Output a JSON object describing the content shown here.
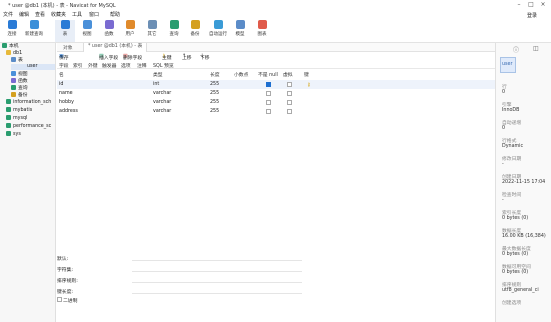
{
  "window": {
    "title": "* user @db1 (本机) - 表 - Navicat for MySQL",
    "login": "登录"
  },
  "menu": [
    "文件",
    "编辑",
    "查看",
    "收藏夹",
    "工具",
    "窗口",
    "帮助"
  ],
  "toolbar": [
    {
      "label": "连接",
      "color": "#2a7bd6"
    },
    {
      "label": "新建查询",
      "color": "#3b8fd9"
    },
    {
      "label": "表",
      "color": "#2a7bd6"
    },
    {
      "label": "视图",
      "color": "#4a90d9"
    },
    {
      "label": "函数",
      "color": "#7a6bd1"
    },
    {
      "label": "用户",
      "color": "#e08a2b"
    },
    {
      "label": "其它",
      "color": "#6c8fb5"
    },
    {
      "label": "查询",
      "color": "#2a9d6f"
    },
    {
      "label": "备份",
      "color": "#d4a020"
    },
    {
      "label": "自动运行",
      "color": "#3a9bd6"
    },
    {
      "label": "模型",
      "color": "#5b8cc8"
    },
    {
      "label": "图表",
      "color": "#e05a4a"
    }
  ],
  "sidebar": {
    "nodes": [
      {
        "label": "本机",
        "color": "#2a9d6f"
      },
      {
        "label": "db1",
        "color": "#e7b93a"
      },
      {
        "label": "表",
        "color": "#5b8cc8"
      },
      {
        "label": "user",
        "color": "#5b8cc8"
      },
      {
        "label": "视图",
        "color": "#4a90d9"
      },
      {
        "label": "函数",
        "color": "#7a6bd1"
      },
      {
        "label": "查询",
        "color": "#2a9d6f"
      },
      {
        "label": "备份",
        "color": "#d4a020"
      },
      {
        "label": "information_sch",
        "color": "#2a9d6f"
      },
      {
        "label": "mybatis",
        "color": "#2a9d6f"
      },
      {
        "label": "mysql",
        "color": "#2a9d6f"
      },
      {
        "label": "performance_sc",
        "color": "#2a9d6f"
      },
      {
        "label": "sys",
        "color": "#2a9d6f"
      }
    ]
  },
  "tabs": {
    "objects": "对象",
    "active": "* user @db1 (本机) - 表"
  },
  "designbar": {
    "save": "保存",
    "add_field": "插入字段",
    "delete_field": "删除字段",
    "primary_key": "主键",
    "up": "上移",
    "down": "下移"
  },
  "subtabs": [
    "字段",
    "索引",
    "外键",
    "触发器",
    "选项",
    "注释",
    "SQL 预览"
  ],
  "grid": {
    "headers": [
      "名",
      "类型",
      "长度",
      "小数点",
      "不是 null",
      "虚拟",
      "键"
    ],
    "rows": [
      {
        "name": "id",
        "type": "int",
        "length": "255",
        "notnull": true,
        "virtual": false,
        "key": true
      },
      {
        "name": "name",
        "type": "varchar",
        "length": "255",
        "notnull": false,
        "virtual": false,
        "key": false
      },
      {
        "name": "hobby",
        "type": "varchar",
        "length": "255",
        "notnull": false,
        "virtual": false,
        "key": false
      },
      {
        "name": "address",
        "type": "varchar",
        "length": "255",
        "notnull": false,
        "virtual": false,
        "key": false
      }
    ]
  },
  "props": {
    "default": "默认:",
    "charset": "字符集:",
    "collation": "排序规则:",
    "key_length": "键长度:",
    "binary": "二进制"
  },
  "right_panel": {
    "table_name": "user",
    "items": [
      {
        "k": "行",
        "v": "0"
      },
      {
        "k": "引擎",
        "v": "InnoDB"
      },
      {
        "k": "自动递增",
        "v": "0"
      },
      {
        "k": "行格式",
        "v": "Dynamic"
      },
      {
        "k": "修改日期",
        "v": "-"
      },
      {
        "k": "创建日期",
        "v": "2022-11-15 17:04"
      },
      {
        "k": "检查时间",
        "v": "-"
      },
      {
        "k": "索引长度",
        "v": "0 bytes (0)"
      },
      {
        "k": "数据长度",
        "v": "16.00 KB (16,384)"
      },
      {
        "k": "最大数据长度",
        "v": "0 bytes (0)"
      },
      {
        "k": "数据可用空间",
        "v": "0 bytes (0)"
      },
      {
        "k": "排序规则",
        "v": "utf8_general_ci"
      },
      {
        "k": "创建选项",
        "v": ""
      }
    ]
  }
}
